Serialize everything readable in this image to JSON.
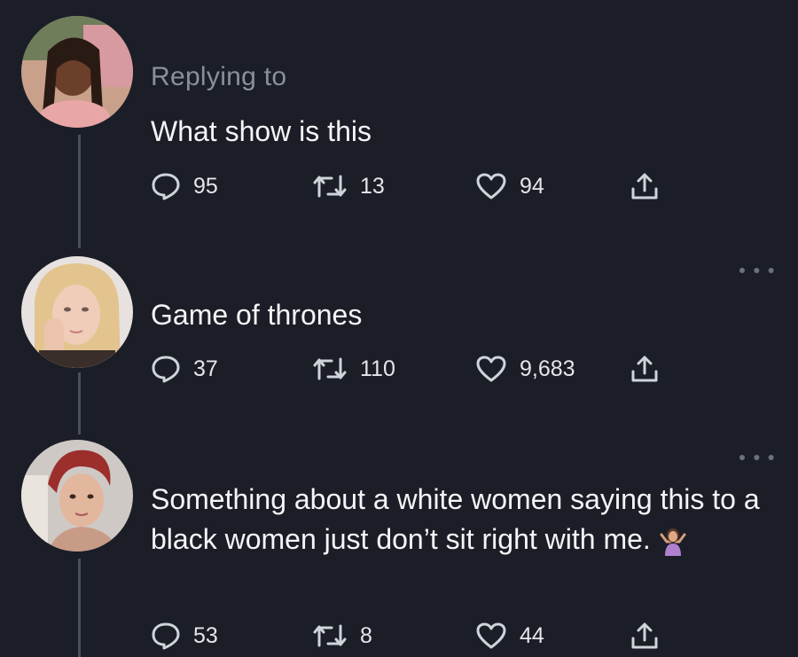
{
  "colors": {
    "background": "#1b1e27",
    "text": "#f4f5f7",
    "muted": "#8a8f99",
    "icon": "#cfd3da"
  },
  "tweets": [
    {
      "replying_to": "Replying to",
      "text": "What show is this",
      "replies": "95",
      "retweets": "13",
      "likes": "94"
    },
    {
      "text": "Game of thrones",
      "replies": "37",
      "retweets": "110",
      "likes": "9,683"
    },
    {
      "text": "Something about a white women saying this to a black women just don’t sit right with me.",
      "replies": "53",
      "retweets": "8",
      "likes": "44",
      "emoji": "woman-shrugging-emoji"
    }
  ],
  "icons": {
    "reply": "reply-icon",
    "retweet": "retweet-icon",
    "like": "heart-icon",
    "share": "share-icon",
    "more": "more-icon"
  }
}
